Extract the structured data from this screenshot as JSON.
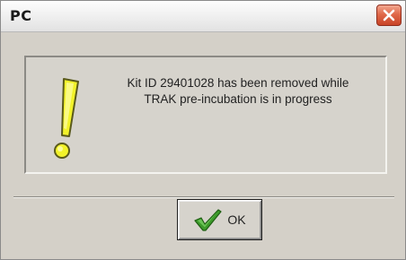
{
  "window": {
    "title": "PC"
  },
  "icons": {
    "close": "close-icon",
    "warning": "exclamation-icon",
    "ok": "checkmark-icon"
  },
  "message": {
    "line1": "Kit ID 29401028 has been removed while",
    "line2": "TRAK pre-incubation is in progress"
  },
  "buttons": {
    "ok_label": "OK"
  },
  "colors": {
    "close_button": "#d9573a",
    "warning_icon": "#f2f22a",
    "checkmark": "#3c9a2a"
  }
}
